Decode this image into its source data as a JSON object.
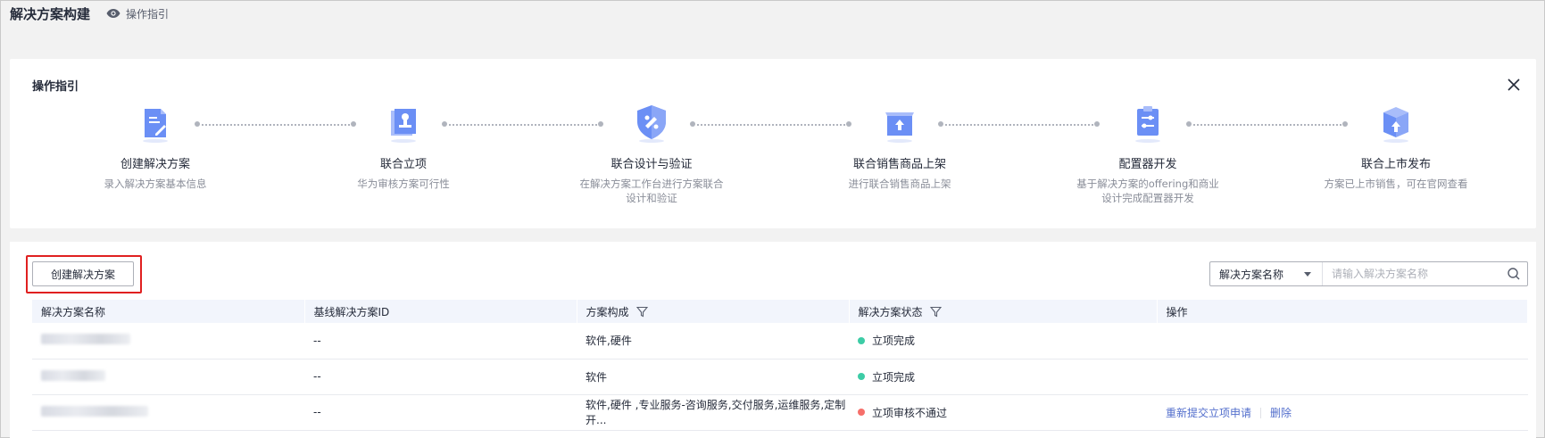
{
  "header": {
    "title": "解决方案构建",
    "guide_link": "操作指引"
  },
  "guide": {
    "title": "操作指引",
    "steps": [
      {
        "title": "创建解决方案",
        "desc": "录入解决方案基本信息",
        "icon": "document-edit-icon"
      },
      {
        "title": "联合立项",
        "desc": "华为审核方案可行性",
        "icon": "stamp-icon"
      },
      {
        "title": "联合设计与验证",
        "desc": "在解决方案工作台进行方案联合设计和验证",
        "icon": "shield-tools-icon"
      },
      {
        "title": "联合销售商品上架",
        "desc": "进行联合销售商品上架",
        "icon": "shelf-upload-icon"
      },
      {
        "title": "配置器开发",
        "desc": "基于解决方案的offering和商业设计完成配置器开发",
        "icon": "clipboard-settings-icon"
      },
      {
        "title": "联合上市发布",
        "desc": "方案已上市销售，可在官网查看",
        "icon": "box-upload-icon"
      }
    ]
  },
  "toolbar": {
    "create_label": "创建解决方案",
    "search_field": "解决方案名称",
    "search_placeholder": "请输入解决方案名称"
  },
  "table": {
    "columns": [
      "解决方案名称",
      "基线解决方案ID",
      "方案构成",
      "解决方案状态",
      "操作"
    ],
    "rows": [
      {
        "baseline": "--",
        "composition": "软件,硬件",
        "status": "立项完成",
        "status_color": "#3dcca6",
        "ops": []
      },
      {
        "baseline": "--",
        "composition": "软件",
        "status": "立项完成",
        "status_color": "#3dcca6",
        "ops": []
      },
      {
        "baseline": "--",
        "composition": "软件,硬件 ,专业服务-咨询服务,交付服务,运维服务,定制开...",
        "status": "立项审核不通过",
        "status_color": "#f66f6a",
        "ops": [
          "重新提交立项申请",
          "删除"
        ]
      }
    ]
  },
  "colors": {
    "accent": "#526ecc",
    "icon_blue": "#6b8ff5",
    "highlight": "#e02020"
  }
}
